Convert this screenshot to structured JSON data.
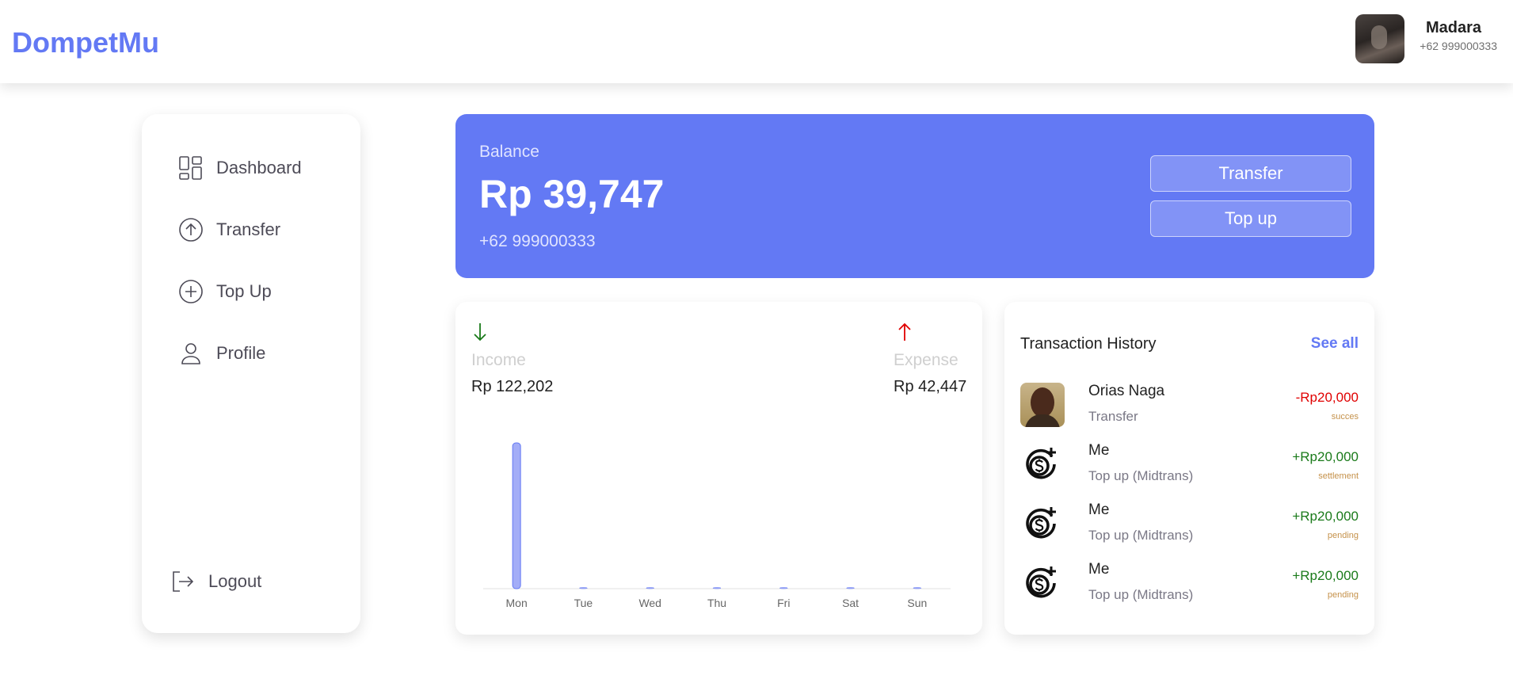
{
  "header": {
    "brand": "DompetMu",
    "user_name": "Madara",
    "user_phone": "+62 999000333"
  },
  "sidebar": {
    "items": [
      {
        "label": "Dashboard",
        "icon": "grid-icon"
      },
      {
        "label": "Transfer",
        "icon": "arrow-up-circle-icon"
      },
      {
        "label": "Top Up",
        "icon": "plus-circle-icon"
      },
      {
        "label": "Profile",
        "icon": "user-icon"
      }
    ],
    "logout_label": "Logout"
  },
  "balance": {
    "label": "Balance",
    "amount": "Rp 39,747",
    "phone": "+62 999000333",
    "transfer_button": "Transfer",
    "topup_button": "Top up"
  },
  "summary": {
    "income_label": "Income",
    "income_value": "Rp 122,202",
    "expense_label": "Expense",
    "expense_value": "Rp 42,447"
  },
  "chart_data": {
    "type": "bar",
    "categories": [
      "Mon",
      "Tue",
      "Wed",
      "Thu",
      "Fri",
      "Sat",
      "Sun"
    ],
    "values": [
      122202,
      0,
      0,
      0,
      0,
      0,
      0
    ],
    "bar_color": "#a3adf7",
    "ylim": [
      0,
      122202
    ]
  },
  "history": {
    "title": "Transaction History",
    "see_all": "See all",
    "transactions": [
      {
        "name": "Orias Naga",
        "type": "Transfer",
        "amount": "-Rp20,000",
        "status": "succes",
        "direction": "out"
      },
      {
        "name": "Me",
        "type": "Top up (Midtrans)",
        "amount": "+Rp20,000",
        "status": "settlement",
        "direction": "in"
      },
      {
        "name": "Me",
        "type": "Top up (Midtrans)",
        "amount": "+Rp20,000",
        "status": "pending",
        "direction": "in"
      },
      {
        "name": "Me",
        "type": "Top up (Midtrans)",
        "amount": "+Rp20,000",
        "status": "pending",
        "direction": "in"
      }
    ]
  },
  "colors": {
    "primary": "#6379f4",
    "income_arrow": "#1a7a1a",
    "expense_arrow": "#e00000"
  }
}
